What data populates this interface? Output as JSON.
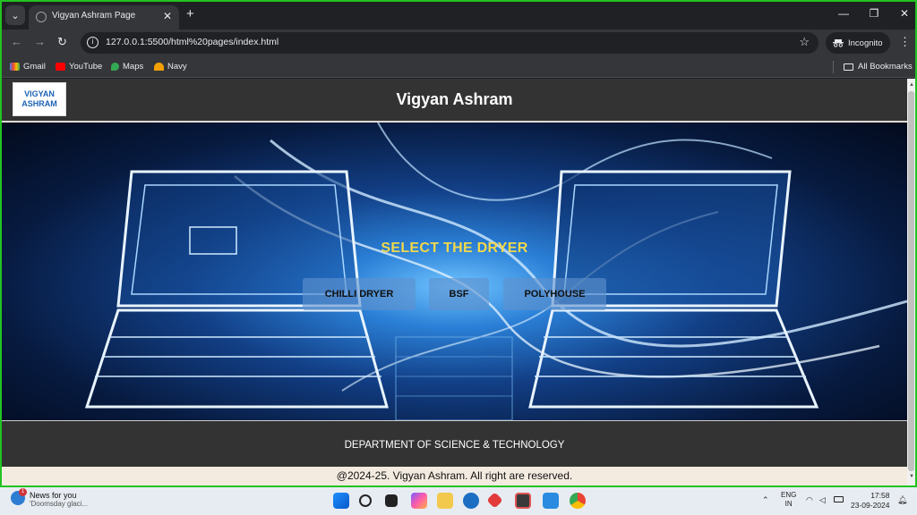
{
  "browser": {
    "tab_title": "Vigyan Ashram Page",
    "url": "127.0.0.1:5500/html%20pages/index.html",
    "incognito_label": "Incognito",
    "bookmarks": [
      "Gmail",
      "YouTube",
      "Maps",
      "Navy"
    ],
    "all_bookmarks": "All Bookmarks"
  },
  "site": {
    "logo_line1": "VIGYAN",
    "logo_line2": "ASHRAM",
    "title": "Vigyan Ashram",
    "hero_heading": "SELECT THE DRYER",
    "buttons": [
      "CHILLI DRYER",
      "BSF",
      "POLYHOUSE"
    ],
    "department": "DEPARTMENT OF SCIENCE & TECHNOLOGY",
    "copyright": "@2024-25. Vigyan Ashram. All right are reserved."
  },
  "taskbar": {
    "news_title": "News for you",
    "news_sub": "'Doomsday glaci...",
    "news_badge": "1",
    "lang_line1": "ENG",
    "lang_line2": "IN",
    "time": "17:58",
    "date": "23-09-2024"
  },
  "colors": {
    "accent_border": "#22c322",
    "heading_yellow": "#f1d84a",
    "header_bg": "#333333"
  }
}
